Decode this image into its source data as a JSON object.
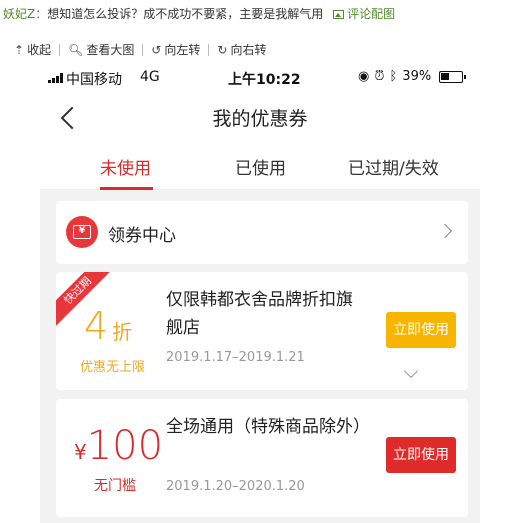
{
  "comment": {
    "user": "妖妃Z：",
    "text": "想知道怎么投诉？成不成功不要紧，主要是我解气用",
    "pic_link": "评论配图"
  },
  "image_toolbar": {
    "collapse": "收起",
    "view_large": "查看大图",
    "rotate_left": "向左转",
    "rotate_right": "向右转"
  },
  "status_bar": {
    "carrier": "中国移动",
    "network": "4G",
    "time": "上午10:22",
    "battery": "39%"
  },
  "header": {
    "title": "我的优惠券"
  },
  "tabs": [
    {
      "label": "未使用",
      "active": true
    },
    {
      "label": "已使用",
      "active": false
    },
    {
      "label": "已过期/失效",
      "active": false
    }
  ],
  "coupon_center": {
    "badge": "¥",
    "label": "领券中心"
  },
  "coupons": [
    {
      "ribbon": "快过期",
      "amount": "4",
      "unit": "折",
      "subtitle": "优惠无上限",
      "title": "仅限韩都衣舍品牌折扣旗舰店",
      "dates": "2019.1.17–2019.1.21",
      "button": "立即使用",
      "accent": "#f7b500"
    },
    {
      "currency": "¥",
      "amount": "100",
      "subtitle": "无门槛",
      "title": "全场通用（特殊商品除外）",
      "dates": "2019.1.20–2020.1.20",
      "button": "立即使用",
      "accent": "#e02b2b"
    }
  ],
  "colors": {
    "brand_red": "#d92b2b",
    "discount_orange": "#f0a81c",
    "comment_green": "#4f8d2a"
  }
}
